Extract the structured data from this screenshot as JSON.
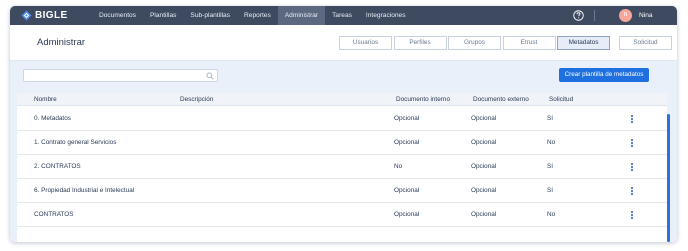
{
  "app": {
    "logo_text": "BIGLE"
  },
  "nav": {
    "items": [
      {
        "label": "Documentos",
        "active": false
      },
      {
        "label": "Plantillas",
        "active": false
      },
      {
        "label": "Sub-plantillas",
        "active": false
      },
      {
        "label": "Reportes",
        "active": false
      },
      {
        "label": "Administrar",
        "active": true
      },
      {
        "label": "Tareas",
        "active": false
      },
      {
        "label": "Integraciones",
        "active": false
      }
    ]
  },
  "user": {
    "initials": "N",
    "name": "Nina"
  },
  "header": {
    "title": "Administrar",
    "tabs": [
      {
        "label": "Usuarios",
        "active": false
      },
      {
        "label": "Perfiles",
        "active": false
      },
      {
        "label": "Grupos",
        "active": false
      },
      {
        "label": "Etrust",
        "active": false
      },
      {
        "label": "Metadatos",
        "active": true
      },
      {
        "label": "Solicitud",
        "active": false
      }
    ]
  },
  "search": {
    "placeholder": "",
    "value": ""
  },
  "actions": {
    "create_label": "Crear plantilla de metadatos"
  },
  "table": {
    "columns": [
      "Nombre",
      "Descripción",
      "Documento interno",
      "Documento externo",
      "Solicitud"
    ],
    "rows": [
      {
        "nombre": "0. Metadatos",
        "descripcion": "",
        "interno": "Opcional",
        "externo": "Opcional",
        "solicitud": "Sí"
      },
      {
        "nombre": "1. Contrato general Servicios",
        "descripcion": "",
        "interno": "Opcional",
        "externo": "Opcional",
        "solicitud": "No"
      },
      {
        "nombre": "2. CONTRATOS",
        "descripcion": "",
        "interno": "No",
        "externo": "Opcional",
        "solicitud": "Sí"
      },
      {
        "nombre": "6. Propiedad Industrial e Intelectual",
        "descripcion": "",
        "interno": "Opcional",
        "externo": "Opcional",
        "solicitud": "Sí"
      },
      {
        "nombre": "CONTRATOS",
        "descripcion": "",
        "interno": "Opcional",
        "externo": "Opcional",
        "solicitud": "No"
      }
    ]
  },
  "colors": {
    "nav_bg": "#3d4a60",
    "nav_active": "#5b6880",
    "primary": "#1e6fe0",
    "content_bg": "#eaf0fa",
    "avatar": "#f5a89a"
  },
  "icons": {
    "logo": "bigle-logo-icon",
    "help": "question-circle-icon",
    "search": "search-icon",
    "row_menu": "kebab-menu-icon"
  }
}
